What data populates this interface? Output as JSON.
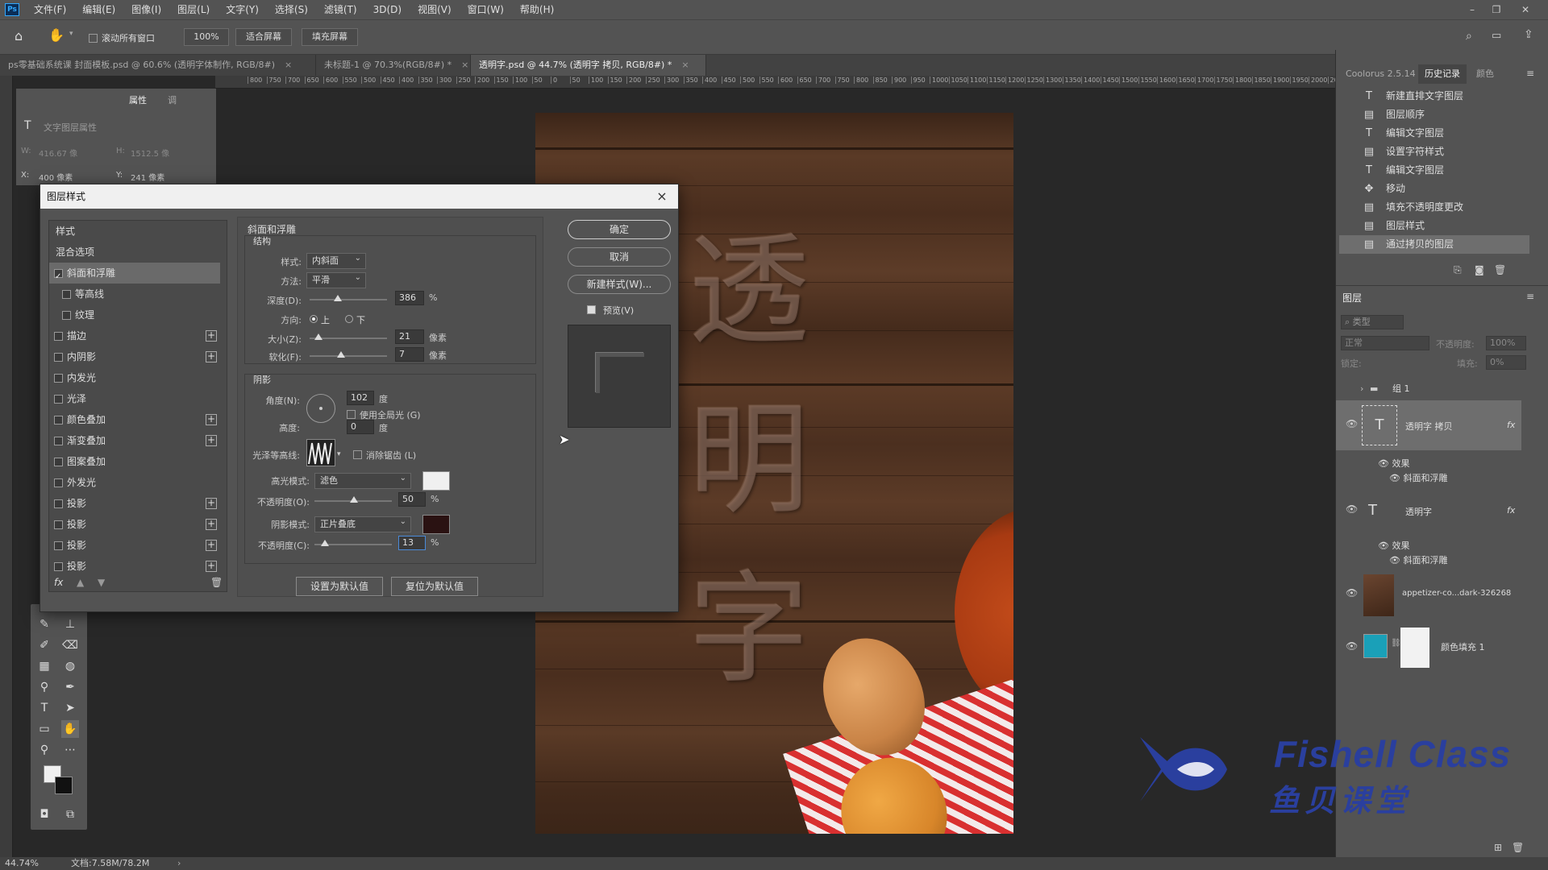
{
  "app": {
    "logo": "Ps"
  },
  "menu": [
    "文件(F)",
    "编辑(E)",
    "图像(I)",
    "图层(L)",
    "文字(Y)",
    "选择(S)",
    "滤镜(T)",
    "3D(D)",
    "视图(V)",
    "窗口(W)",
    "帮助(H)"
  ],
  "options": {
    "scroll_all": "滚动所有窗口",
    "zoom": "100%",
    "fit_screen": "适合屏幕",
    "fill_screen": "填充屏幕"
  },
  "tabs": [
    {
      "label": "ps零基础系统课 封面模板.psd @ 60.6% (透明字体制作, RGB/8#)",
      "close": "×"
    },
    {
      "label": "未标题-1 @ 70.3%(RGB/8#) *",
      "close": "×"
    },
    {
      "label": "透明字.psd @ 44.7% (透明字 拷贝, RGB/8#) *",
      "close": "×"
    }
  ],
  "ruler_ticks": [
    "800",
    "750",
    "700",
    "650",
    "600",
    "550",
    "500",
    "450",
    "400",
    "350",
    "300",
    "250",
    "200",
    "150",
    "100",
    "50",
    "0",
    "50",
    "100",
    "150",
    "200",
    "250",
    "300",
    "350",
    "400",
    "450",
    "500",
    "550",
    "600",
    "650",
    "700",
    "750",
    "800",
    "850",
    "900",
    "950",
    "1000",
    "1050",
    "1100",
    "1150",
    "1200",
    "1250",
    "1300",
    "1350",
    "1400",
    "1450",
    "1500",
    "1550",
    "1600",
    "1650",
    "1700",
    "1750",
    "1800",
    "1850",
    "1900",
    "1950",
    "2000",
    "2050",
    "2100"
  ],
  "props_panel": {
    "tabs": [
      "属性",
      "调"
    ],
    "title": "文字图层属性",
    "w_label": "W:",
    "w_value": "416.67 像",
    "h_label": "H:",
    "h_value": "1512.5 像",
    "x_label": "X:",
    "x_value": "400 像素",
    "y_label": "Y:",
    "y_value": "241 像素"
  },
  "canvas_text": [
    "透",
    "明",
    "字"
  ],
  "dialog": {
    "title": "图层样式",
    "close": "×",
    "style_list": [
      {
        "label": "样式",
        "kind": "head"
      },
      {
        "label": "混合选项",
        "kind": "head"
      },
      {
        "label": "斜面和浮雕",
        "checked": true,
        "selected": true
      },
      {
        "label": "等高线",
        "sub": true
      },
      {
        "label": "纹理",
        "sub": true
      },
      {
        "label": "描边",
        "plus": true
      },
      {
        "label": "内阴影",
        "plus": true
      },
      {
        "label": "内发光"
      },
      {
        "label": "光泽"
      },
      {
        "label": "颜色叠加",
        "plus": true
      },
      {
        "label": "渐变叠加",
        "plus": true
      },
      {
        "label": "图案叠加"
      },
      {
        "label": "外发光"
      },
      {
        "label": "投影",
        "plus": true
      },
      {
        "label": "投影",
        "plus": true
      },
      {
        "label": "投影",
        "plus": true
      },
      {
        "label": "投影",
        "plus": true
      }
    ],
    "footer_fx": "fx",
    "section_title": "斜面和浮雕",
    "structure": {
      "title": "结构",
      "style_label": "样式:",
      "style_value": "内斜面",
      "technique_label": "方法:",
      "technique_value": "平滑",
      "depth_label": "深度(D):",
      "depth_value": "386",
      "depth_unit": "%",
      "direction_label": "方向:",
      "dir_up": "上",
      "dir_down": "下",
      "size_label": "大小(Z):",
      "size_value": "21",
      "size_unit": "像素",
      "soften_label": "软化(F):",
      "soften_value": "7",
      "soften_unit": "像素"
    },
    "shading": {
      "title": "阴影",
      "angle_label": "角度(N):",
      "angle_value": "102",
      "angle_unit": "度",
      "global_light": "使用全局光 (G)",
      "altitude_label": "高度:",
      "altitude_value": "0",
      "altitude_unit": "度",
      "gloss_label": "光泽等高线:",
      "anti_alias": "消除锯齿 (L)",
      "highlight_label": "高光模式:",
      "highlight_value": "滤色",
      "hl_opacity_label": "不透明度(O):",
      "hl_opacity_value": "50",
      "hl_opacity_unit": "%",
      "shadow_label": "阴影模式:",
      "shadow_value": "正片叠底",
      "sh_opacity_label": "不透明度(C):",
      "sh_opacity_value": "13",
      "sh_opacity_unit": "%"
    },
    "make_default": "设置为默认值",
    "reset_default": "复位为默认值",
    "ok": "确定",
    "cancel": "取消",
    "new_style": "新建样式(W)...",
    "preview": "预览(V)"
  },
  "right_panel": {
    "tabs": [
      "Coolorus 2.5.14",
      "历史记录",
      "颜色"
    ],
    "history": [
      {
        "icon": "T",
        "label": "新建直排文字图层"
      },
      {
        "icon": "▤",
        "label": "图层顺序"
      },
      {
        "icon": "T",
        "label": "编辑文字图层"
      },
      {
        "icon": "▤",
        "label": "设置字符样式"
      },
      {
        "icon": "T",
        "label": "编辑文字图层"
      },
      {
        "icon": "✥",
        "label": "移动"
      },
      {
        "icon": "▤",
        "label": "填充不透明度更改"
      },
      {
        "icon": "▤",
        "label": "图层样式"
      },
      {
        "icon": "▤",
        "label": "通过拷贝的图层",
        "selected": true
      }
    ],
    "layers_title": "图层",
    "filter": "类型",
    "blend_mode": "正常",
    "opacity_label": "不透明度:",
    "opacity_value": "100%",
    "lock_label": "锁定:",
    "fill_label": "填充:",
    "fill_value": "0%",
    "layers": [
      {
        "name": "组 1",
        "kind": "group"
      },
      {
        "name": "透明字 拷贝",
        "kind": "text",
        "fx": "fx",
        "selected": true,
        "effects": "效果",
        "effect": "斜面和浮雕"
      },
      {
        "name": "透明字",
        "kind": "text",
        "fx": "fx",
        "effects": "效果",
        "effect": "斜面和浮雕"
      },
      {
        "name": "appetizer-co...dark-326268",
        "kind": "image"
      },
      {
        "name": "颜色填充 1",
        "kind": "fill"
      }
    ]
  },
  "status": {
    "zoom": "44.74%",
    "doc": "文档:7.58M/78.2M"
  },
  "watermark": {
    "en": "Fishell Class",
    "cn": "鱼贝课堂"
  },
  "colors": {
    "accent": "#31a8ff",
    "watermark": "#2a3f9e",
    "fill_swatch": "#1aa0b8"
  }
}
